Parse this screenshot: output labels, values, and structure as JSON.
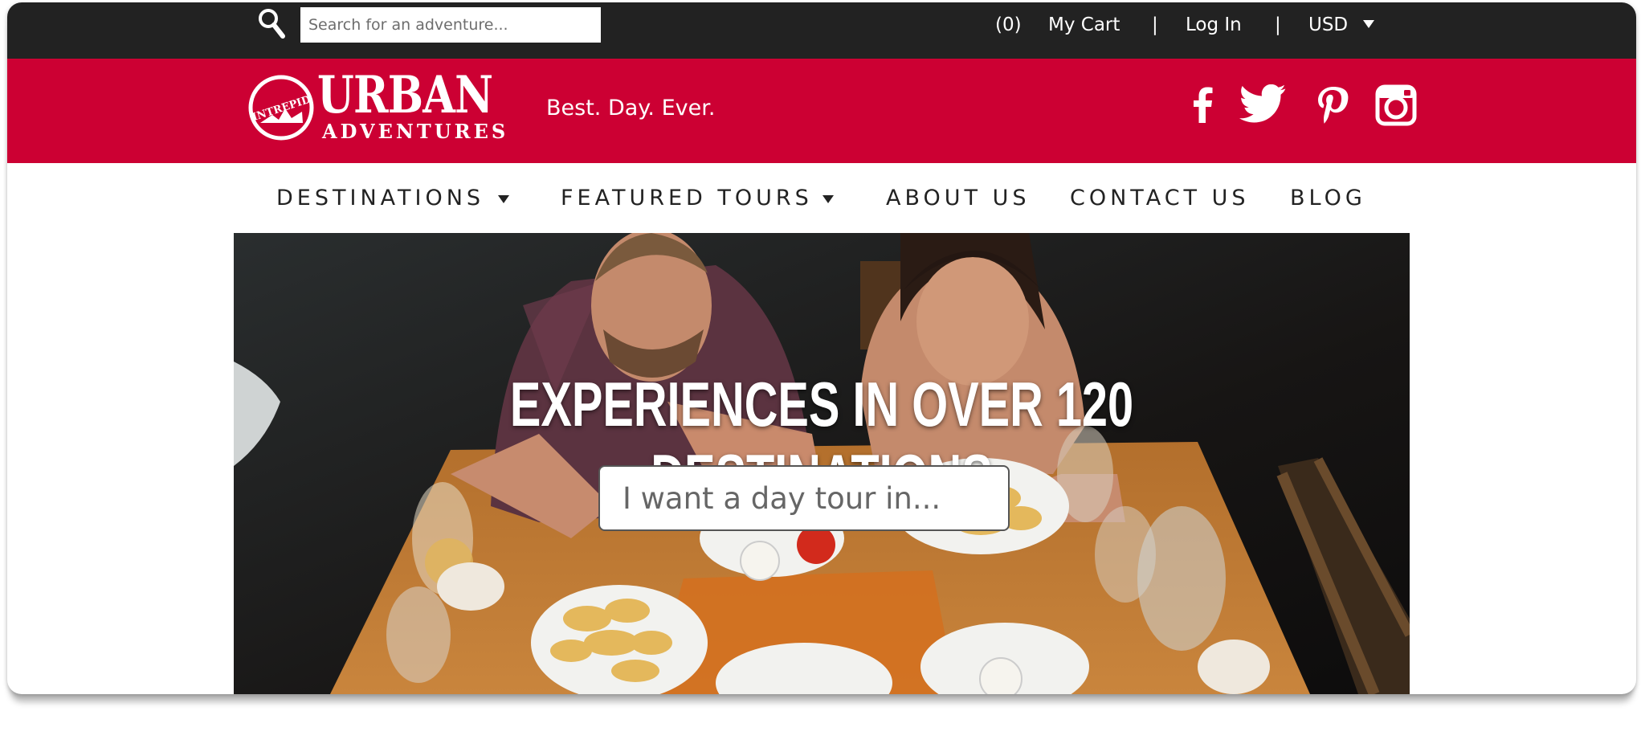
{
  "topbar": {
    "search": {
      "placeholder": "Search for an adventure..."
    },
    "cart_count": "(0)",
    "cart_label": "My Cart",
    "separator": "|",
    "login_label": "Log In",
    "currency": "USD"
  },
  "brand": {
    "logo_circle_text": "INTREPID",
    "logo_main": "URBAN",
    "logo_sub": "ADVENTURES",
    "tagline": "Best. Day. Ever.",
    "social_icons": [
      "facebook-icon",
      "twitter-icon",
      "pinterest-icon",
      "instagram-icon"
    ],
    "colors": {
      "brand_red": "#cc0033",
      "topbar": "#222222"
    }
  },
  "nav": {
    "items": [
      {
        "label": "DESTINATIONS",
        "dropdown": true
      },
      {
        "label": "FEATURED TOURS",
        "dropdown": true
      },
      {
        "label": "ABOUT US",
        "dropdown": false
      },
      {
        "label": "CONTACT US",
        "dropdown": false
      },
      {
        "label": "BLOG",
        "dropdown": false
      }
    ]
  },
  "hero": {
    "title": "EXPERIENCES IN OVER 120 DESTINATIONS",
    "search": {
      "placeholder": "I want a day tour in..."
    }
  }
}
